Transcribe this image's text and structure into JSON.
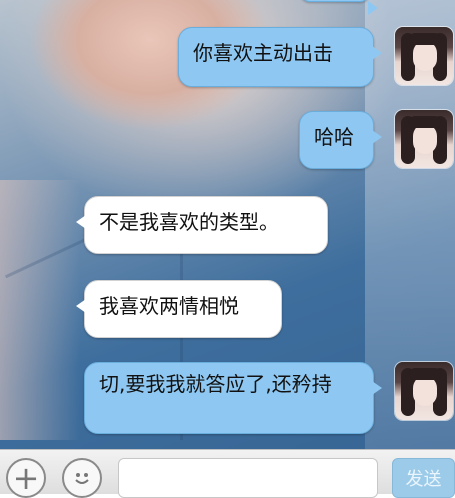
{
  "messages": [
    {
      "side": "out",
      "text": "你喜欢主动出击"
    },
    {
      "side": "out",
      "text": "哈哈"
    },
    {
      "side": "in",
      "text": "不是我喜欢的类型。"
    },
    {
      "side": "in",
      "text": "我喜欢两情相悦"
    },
    {
      "side": "out",
      "text": "切,要我我就答应了,还矜持"
    }
  ],
  "input": {
    "placeholder": "",
    "send_label": "发送"
  },
  "icons": {
    "plus": "plus-icon",
    "emoji": "emoji-icon"
  },
  "colors": {
    "outgoing_bubble": "#8ec8f2",
    "incoming_bubble": "#ffffff",
    "send_button": "#9ccbe9"
  }
}
